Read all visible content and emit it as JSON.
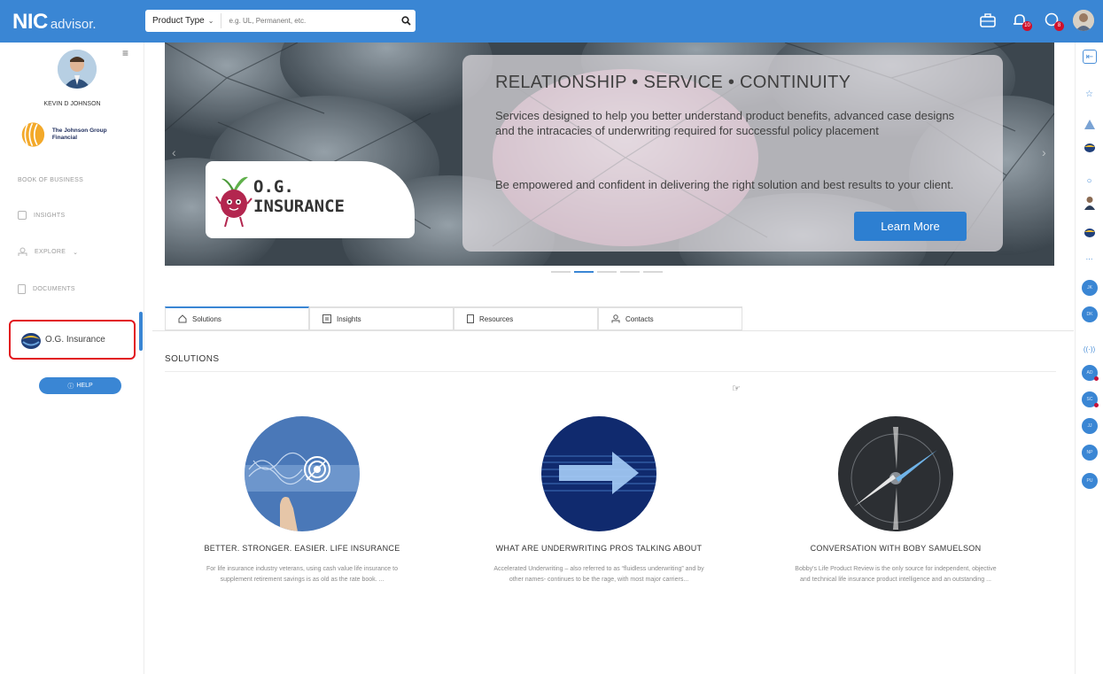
{
  "header": {
    "logo_main": "NIC",
    "logo_sub": "advisor.",
    "search": {
      "type_label": "Product Type",
      "placeholder": "e.g. UL, Permanent, etc.",
      "icon": "search-icon"
    },
    "icons": [
      "briefcase-icon",
      "notification-icon",
      "chat-icon",
      "user-avatar"
    ],
    "notification_badge": "10",
    "chat_badge": "8"
  },
  "sidebar": {
    "user_name": "KEVIN D JOHNSON",
    "company_name": "The Johnson Group Financial",
    "items": [
      {
        "label": "BOOK OF BUSINESS"
      },
      {
        "label": "INSIGHTS"
      },
      {
        "label": "EXPLORE"
      },
      {
        "label": "DOCUMENTS"
      }
    ],
    "selected_item": "O.G. Insurance",
    "help_label": "HELP"
  },
  "hero": {
    "title": "RELATIONSHIP • SERVICE • CONTINUITY",
    "paragraph1": "Services designed to help you better understand product benefits, advanced case designs and the intracacies of underwriting required for successful policy placement",
    "paragraph2": "Be empowered and confident in delivering the right solution and best results to your client.",
    "button": "Learn More",
    "brand_line1": "O.G.",
    "brand_line2": "INSURANCE",
    "slide_count": 5,
    "active_slide": 2
  },
  "tabs": [
    {
      "label": "Solutions",
      "icon": "home-icon"
    },
    {
      "label": "Insights",
      "icon": "insights-icon"
    },
    {
      "label": "Resources",
      "icon": "document-icon"
    },
    {
      "label": "Contacts",
      "icon": "contacts-icon"
    }
  ],
  "section_title": "SOLUTIONS",
  "cards": [
    {
      "title": "BETTER. STRONGER. EASIER. LIFE INSURANCE",
      "description": "For life insurance industry veterans, using cash value life insurance to supplement retirement savings is as old as the rate book. ..."
    },
    {
      "title": "WHAT ARE UNDERWRITING PROS TALKING ABOUT",
      "description": "Accelerated Underwriting – also referred to as “fluidless underwriting” and by other names- continues to be the rage, with most major carriers..."
    },
    {
      "title": "CONVERSATION WITH BOBY SAMUELSON",
      "description": "Bobby's Life Product Review is the only source for independent, objective and technical life insurance product intelligence and an outstanding ..."
    }
  ],
  "right_rail": {
    "initials": [
      "JK",
      "DK",
      "AD",
      "SC",
      "JJ",
      "NP",
      "PU"
    ]
  },
  "colors": {
    "primary": "#3a86d4",
    "highlight_border": "#e2141c",
    "badge": "#d0112b"
  }
}
